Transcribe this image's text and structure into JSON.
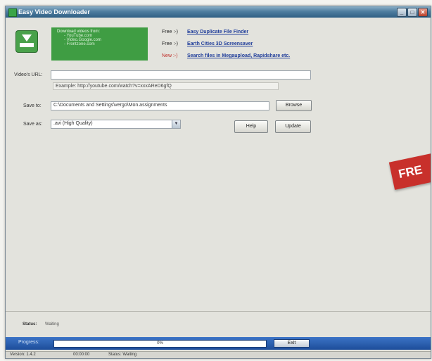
{
  "window": {
    "title": "Easy Video Downloader"
  },
  "promo_box": {
    "heading": "Download videos from:",
    "sites": [
      "- YouTube.com",
      "- Video.Google.com",
      "- Frontzone.com"
    ]
  },
  "promos": [
    {
      "tag": "Free :-)",
      "text": "Easy Duplicate File Finder"
    },
    {
      "tag": "Free :-)",
      "text": "Earth Cities 3D Screensaver"
    },
    {
      "tag": "New :-)",
      "text": "Search files in Megaupload, Rapidshare etc."
    }
  ],
  "form": {
    "url_label": "Video's URL:",
    "url_value": "",
    "example_text": "Example: http://youtube.com/watch?v=xxxAReD6gfQ",
    "save_to_label": "Save to:",
    "save_to_value": "C:\\Documents and Settings\\vergo\\Mon.assignments",
    "browse_label": "Browse",
    "save_as_label": "Save as:",
    "save_as_value": ".avi (High Quality)",
    "help_label": "Help",
    "update_label": "Update"
  },
  "ribbon_text": "FRE",
  "status": {
    "label": "Status:",
    "value": "Waiting"
  },
  "progress": {
    "label": "Progress:",
    "percent_text": "0%",
    "fraction": 0.0,
    "exit_label": "Exit"
  },
  "statusbar": {
    "version": "Version: 1.4.2",
    "time": "00:00:00",
    "state": "Status: Waiting"
  },
  "colors": {
    "accent_green": "#3f9d43",
    "ribbon_red": "#c8302b",
    "progress_blue": "#2a5fae"
  }
}
